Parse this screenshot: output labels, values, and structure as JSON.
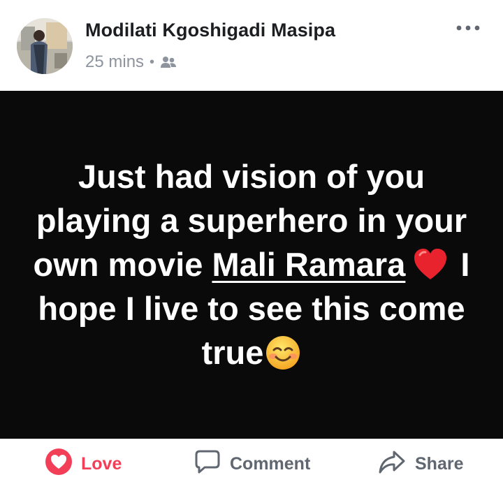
{
  "post": {
    "author_name": "Modilati Kgoshigadi Masipa",
    "timestamp": "25 mins",
    "separator": "•",
    "audience_icon": "friends-icon",
    "menu_icon": "more-options-icon"
  },
  "status": {
    "text_before": "Just had vision of you playing a superhero in your own movie ",
    "mention": "Mali Ramara",
    "text_after": " I hope I live to see this come true",
    "emoji_1": "red-heart",
    "emoji_2": "smiling-face-with-smiling-eyes",
    "background_color": "#0a0a0a",
    "text_color": "#ffffff"
  },
  "actions": {
    "love_label": "Love",
    "comment_label": "Comment",
    "share_label": "Share",
    "love_color": "#f33e58"
  }
}
